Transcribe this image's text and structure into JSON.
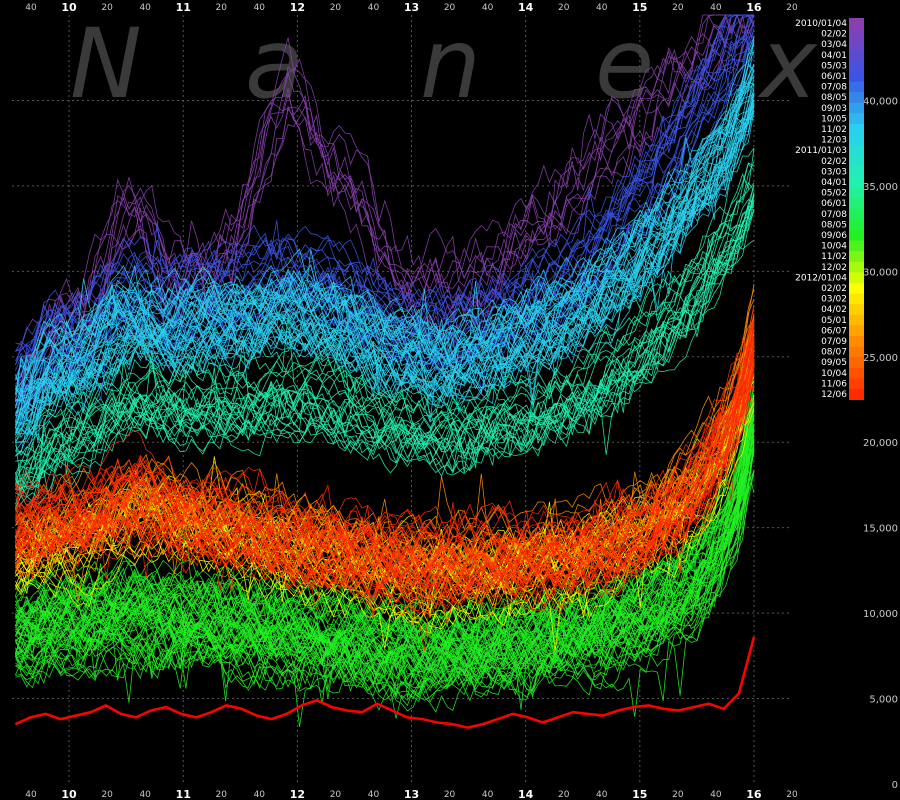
{
  "watermark": [
    "N",
    "a",
    "n",
    "e",
    "x"
  ],
  "chart_data": {
    "type": "line",
    "title": "",
    "xlabel": "",
    "ylabel": "",
    "x_major_ticks": [
      "10",
      "11",
      "12",
      "13",
      "14",
      "15",
      "16"
    ],
    "x_minor_ticks": [
      "40",
      "20",
      "40",
      "20",
      "40",
      "20",
      "40",
      "20",
      "40",
      "20",
      "40",
      "20",
      "40",
      "20",
      "40",
      "20"
    ],
    "y_ticks": [
      "0",
      "5,000",
      "10,000",
      "15,000",
      "20,000",
      "25,000",
      "30,000",
      "35,000",
      "40,000"
    ],
    "ylim": [
      0,
      45000
    ],
    "xlim": [
      "09:30",
      "16:20"
    ],
    "grid": true,
    "legend_position": "right",
    "legend": [
      "2010/01/04",
      "02/02",
      "03/04",
      "04/01",
      "05/03",
      "06/01",
      "07/08",
      "08/05",
      "09/03",
      "10/05",
      "11/02",
      "12/03",
      "2011/01/03",
      "02/02",
      "03/03",
      "04/01",
      "05/02",
      "06/01",
      "07/08",
      "08/05",
      "09/06",
      "10/04",
      "11/02",
      "12/02",
      "2012/01/04",
      "02/02",
      "03/02",
      "04/02",
      "05/01",
      "06/07",
      "07/09",
      "08/07",
      "09/05",
      "10/04",
      "11/06",
      "12/06"
    ],
    "color_scale": [
      "#8a3fb0",
      "#3a55e6",
      "#2ad0f0",
      "#22f0b0",
      "#22f022",
      "#ffff00",
      "#ff8c00",
      "#ff2a00"
    ],
    "highlight_series": {
      "name": "12/06",
      "color": "#ff0000",
      "values": [
        3500,
        3900,
        4100,
        3800,
        4000,
        4200,
        4600,
        4100,
        3900,
        4300,
        4500,
        4100,
        3900,
        4200,
        4600,
        4400,
        4000,
        3800,
        4100,
        4600,
        4900,
        4500,
        4300,
        4200,
        4700,
        4300,
        3900,
        3800,
        3600,
        3500,
        3300,
        3500,
        3800,
        4100,
        3900,
        3600,
        3900,
        4200,
        4100,
        4000,
        4300,
        4500,
        4600,
        4400,
        4300,
        4500,
        4700,
        4400,
        5300,
        8600
      ]
    },
    "bands": [
      {
        "color": "#8a3fb0",
        "lines": 10,
        "values": [
          24000,
          24600,
          26200,
          27400,
          27200,
          28800,
          30600,
          33600,
          34000,
          32600,
          30200,
          30000,
          31000,
          30800,
          31600,
          33400,
          36000,
          38800,
          40800,
          40200,
          37800,
          36400,
          35600,
          34400,
          31800,
          30400,
          30000,
          29800,
          29600,
          29200,
          29400,
          30200,
          31200,
          32200,
          33400,
          34400,
          35000,
          36000,
          37000,
          37800,
          38600,
          39400,
          40200,
          41000,
          41800,
          42600,
          43400,
          44200,
          45000,
          45500
        ]
      },
      {
        "color": "#3a55e6",
        "lines": 22,
        "values": [
          22800,
          24000,
          25400,
          25800,
          26000,
          26800,
          27800,
          28800,
          29000,
          28400,
          27800,
          28000,
          28400,
          28600,
          28400,
          28800,
          29000,
          29400,
          29600,
          29400,
          29200,
          28800,
          28600,
          28000,
          27400,
          27000,
          26800,
          26600,
          26400,
          26400,
          26600,
          26900,
          27300,
          27800,
          28200,
          28700,
          29200,
          29800,
          30600,
          31600,
          32600,
          33800,
          35000,
          36400,
          37800,
          39200,
          40600,
          42000,
          43400,
          45000
        ]
      },
      {
        "color": "#2ad0f0",
        "lines": 42,
        "values": [
          21400,
          22600,
          24000,
          24400,
          24700,
          25300,
          26200,
          27000,
          27300,
          27000,
          26600,
          26700,
          26900,
          27100,
          27000,
          27200,
          27300,
          27600,
          27700,
          27500,
          27300,
          27000,
          26800,
          26300,
          25800,
          25500,
          25300,
          25100,
          24900,
          24900,
          25100,
          25300,
          25600,
          26000,
          26300,
          26700,
          27000,
          27500,
          28100,
          28800,
          29500,
          30300,
          31200,
          32200,
          33300,
          34500,
          35800,
          37200,
          38800,
          41000
        ]
      },
      {
        "color": "#22f0b0",
        "lines": 26,
        "values": [
          18400,
          19200,
          20200,
          20600,
          20900,
          21500,
          22200,
          22800,
          23100,
          22900,
          22600,
          22700,
          22800,
          22900,
          22800,
          22900,
          23000,
          23200,
          23300,
          23100,
          22900,
          22700,
          22500,
          22100,
          21700,
          21500,
          21300,
          21100,
          20900,
          20900,
          21100,
          21300,
          21500,
          21800,
          22000,
          22300,
          22600,
          23000,
          23500,
          24100,
          24800,
          25500,
          26300,
          27200,
          28200,
          29300,
          30500,
          31800,
          33200,
          35000
        ]
      },
      {
        "color": "#22f022",
        "lines": 60,
        "values": [
          8800,
          9000,
          9200,
          9300,
          9400,
          9600,
          9800,
          9900,
          10000,
          9800,
          9600,
          9500,
          9500,
          9400,
          9300,
          9200,
          9100,
          9000,
          8900,
          8800,
          8700,
          8600,
          8400,
          8200,
          8100,
          8000,
          7900,
          7800,
          7800,
          7800,
          7900,
          8000,
          8100,
          8200,
          8300,
          8400,
          8500,
          8700,
          8900,
          9100,
          9400,
          9700,
          10100,
          10600,
          11200,
          12000,
          13000,
          14500,
          17000,
          21000
        ]
      },
      {
        "color": "#ffff00",
        "lines": 24,
        "values": [
          12600,
          12900,
          13300,
          13500,
          13700,
          14100,
          14600,
          15100,
          15500,
          15400,
          15100,
          14800,
          14600,
          14400,
          14200,
          14000,
          13800,
          13600,
          13400,
          13200,
          13000,
          12800,
          12600,
          12300,
          12100,
          11900,
          11800,
          11700,
          11700,
          11800,
          11900,
          12000,
          12100,
          12200,
          12300,
          12400,
          12500,
          12700,
          12900,
          13200,
          13500,
          13900,
          14300,
          14800,
          15400,
          16200,
          17200,
          18600,
          20800,
          24000
        ]
      },
      {
        "color": "#ff8c00",
        "lines": 20,
        "values": [
          14200,
          14500,
          14800,
          15000,
          15200,
          15600,
          16100,
          16600,
          17000,
          16900,
          16600,
          16300,
          16100,
          15900,
          15700,
          15500,
          15300,
          15100,
          14900,
          14700,
          14500,
          14300,
          14100,
          13800,
          13600,
          13400,
          13300,
          13200,
          13200,
          13300,
          13400,
          13500,
          13600,
          13700,
          13800,
          13900,
          14000,
          14200,
          14400,
          14700,
          15000,
          15400,
          15900,
          16500,
          17300,
          18300,
          19600,
          21300,
          23600,
          27000
        ]
      },
      {
        "color": "#ff2a00",
        "lines": 38,
        "values": [
          15200,
          15400,
          15600,
          15700,
          15800,
          16100,
          16400,
          16600,
          16800,
          16600,
          16300,
          16000,
          15700,
          15400,
          15200,
          15000,
          14800,
          14600,
          14400,
          14200,
          14000,
          13900,
          13800,
          13600,
          13500,
          13400,
          13300,
          13300,
          13300,
          13300,
          13300,
          13400,
          13400,
          13400,
          13400,
          13500,
          13500,
          13600,
          13700,
          13900,
          14200,
          14600,
          15100,
          15700,
          16500,
          17500,
          18800,
          20500,
          22800,
          26000
        ]
      }
    ]
  }
}
